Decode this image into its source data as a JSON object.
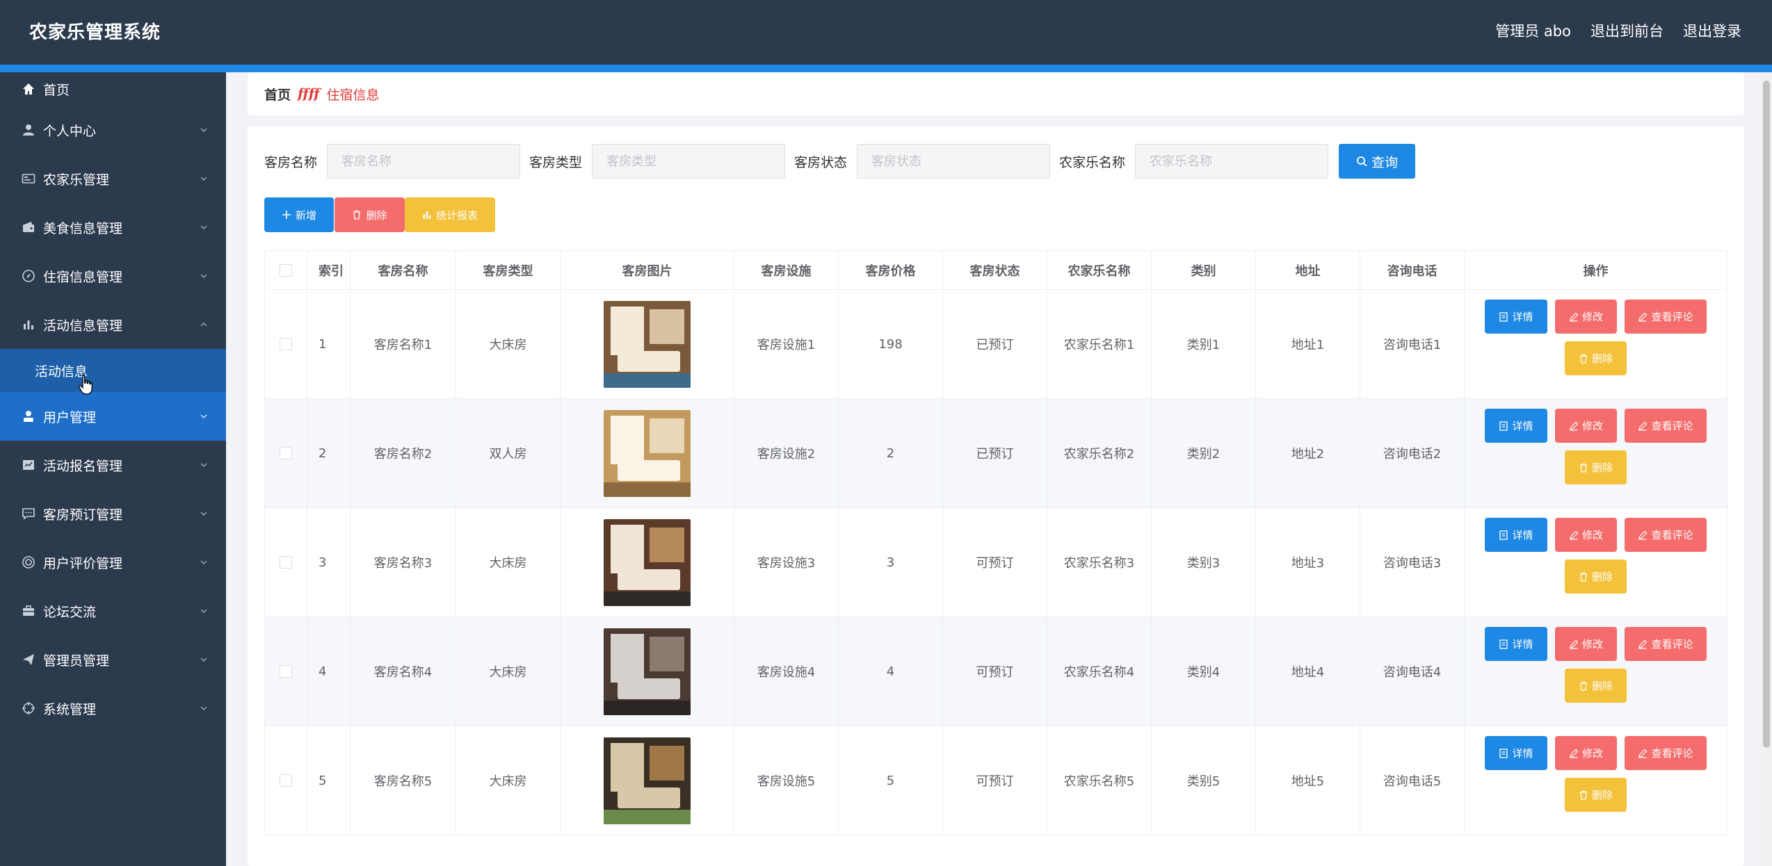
{
  "app": {
    "title": "农家乐管理系统",
    "user_label": "管理员 abo",
    "to_front_label": "退出到前台",
    "logout_label": "退出登录"
  },
  "sidebar": {
    "home": "首页",
    "items": [
      {
        "label": "个人中心",
        "icon": "user-icon"
      },
      {
        "label": "农家乐管理",
        "icon": "id-card-icon"
      },
      {
        "label": "美食信息管理",
        "icon": "wallet-icon"
      },
      {
        "label": "住宿信息管理",
        "icon": "compass-icon"
      },
      {
        "label": "活动信息管理",
        "icon": "bar-chart-icon",
        "expanded": true
      },
      {
        "label": "用户管理",
        "icon": "user-solid-icon",
        "highlighted": true
      },
      {
        "label": "活动报名管理",
        "icon": "checked-chart-icon"
      },
      {
        "label": "客房预订管理",
        "icon": "chat-icon"
      },
      {
        "label": "用户评价管理",
        "icon": "target-icon"
      },
      {
        "label": "论坛交流",
        "icon": "briefcase-icon"
      },
      {
        "label": "管理员管理",
        "icon": "send-icon"
      },
      {
        "label": "系统管理",
        "icon": "crosshair-icon"
      }
    ],
    "sub_item": "活动信息"
  },
  "breadcrumb": {
    "home": "首页",
    "separator": "ffff",
    "current": "住宿信息"
  },
  "search": {
    "room_name_label": "客房名称",
    "room_name_placeholder": "客房名称",
    "room_type_label": "客房类型",
    "room_type_placeholder": "客房类型",
    "room_status_label": "客房状态",
    "room_status_placeholder": "客房状态",
    "farm_name_label": "农家乐名称",
    "farm_name_placeholder": "农家乐名称",
    "query_label": "查询"
  },
  "actions": {
    "add_label": "新增",
    "delete_label": "删除",
    "stats_label": "统计报表"
  },
  "table": {
    "headers": [
      "索引",
      "客房名称",
      "客房类型",
      "客房图片",
      "客房设施",
      "客房价格",
      "客房状态",
      "农家乐名称",
      "类别",
      "地址",
      "咨询电话",
      "操作"
    ],
    "op_labels": {
      "detail": "详情",
      "edit": "修改",
      "review": "查看评论",
      "delete": "删除"
    },
    "rows": [
      {
        "index": "1",
        "name": "客房名称1",
        "type": "大床房",
        "facility": "客房设施1",
        "price": "198",
        "status": "已预订",
        "farm": "农家乐名称1",
        "category": "类别1",
        "address": "地址1",
        "phone": "咨询电话1"
      },
      {
        "index": "2",
        "name": "客房名称2",
        "type": "双人房",
        "facility": "客房设施2",
        "price": "2",
        "status": "已预订",
        "farm": "农家乐名称2",
        "category": "类别2",
        "address": "地址2",
        "phone": "咨询电话2"
      },
      {
        "index": "3",
        "name": "客房名称3",
        "type": "大床房",
        "facility": "客房设施3",
        "price": "3",
        "status": "可预订",
        "farm": "农家乐名称3",
        "category": "类别3",
        "address": "地址3",
        "phone": "咨询电话3"
      },
      {
        "index": "4",
        "name": "客房名称4",
        "type": "大床房",
        "facility": "客房设施4",
        "price": "4",
        "status": "可预订",
        "farm": "农家乐名称4",
        "category": "类别4",
        "address": "地址4",
        "phone": "咨询电话4"
      },
      {
        "index": "5",
        "name": "客房名称5",
        "type": "大床房",
        "facility": "客房设施5",
        "price": "5",
        "status": "可预订",
        "farm": "农家乐名称5",
        "category": "类别5",
        "address": "地址5",
        "phone": "咨询电话5"
      }
    ]
  },
  "colors": {
    "header_bg": "#2c3a4e",
    "accent_blue": "#1e88e5",
    "danger_red": "#f56c6c",
    "warning_yellow": "#f3c13a",
    "breadcrumb_red": "#e53935"
  }
}
